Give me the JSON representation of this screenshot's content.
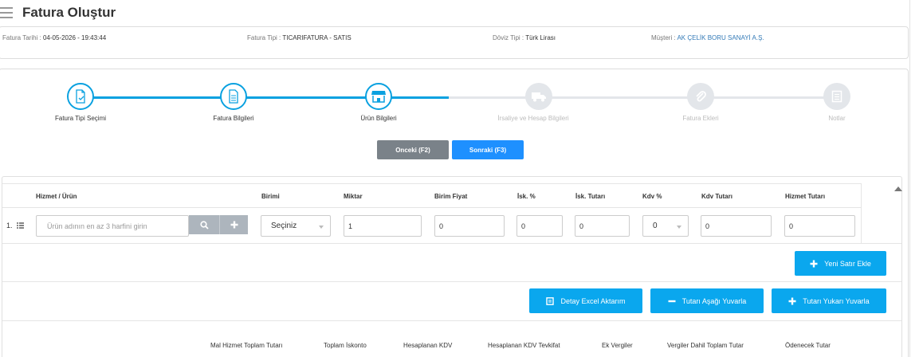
{
  "header": {
    "title": "Fatura Oluştur",
    "menu_icon": "hamburger-icon"
  },
  "info": {
    "date_label": "Fatura Tarihi : ",
    "date_value": "04-05-2026 - 19:43:44",
    "type_label": "Fatura Tipi : ",
    "type_value": "TICARIFATURA - SATIS",
    "currency_label": "Döviz Tipi : ",
    "currency_value": "Türk Lirası",
    "customer_label": "Müşteri : ",
    "customer_value": "AK ÇELİK BORU SANAYİ A.Ş."
  },
  "steps": [
    {
      "label": "Fatura Tipi Seçimi",
      "icon": "document-check-icon",
      "state": "done"
    },
    {
      "label": "Fatura Bilgileri",
      "icon": "document-text-icon",
      "state": "done"
    },
    {
      "label": "Ürün Bilgileri",
      "icon": "store-icon",
      "state": "active"
    },
    {
      "label": "İrsaliye ve Hesap Bilgileri",
      "icon": "truck-icon",
      "state": "pending"
    },
    {
      "label": "Fatura Ekleri",
      "icon": "paperclip-icon",
      "state": "pending"
    },
    {
      "label": "Notlar",
      "icon": "notes-icon",
      "state": "pending"
    }
  ],
  "nav": {
    "prev_label": "Onceki (F2)",
    "next_label": "Sonraki (F3)"
  },
  "table": {
    "columns": [
      "Hizmet / Ürün",
      "Birimi",
      "Miktar",
      "Birim Fiyat",
      "İsk. %",
      "İsk. Tutarı",
      "Kdv %",
      "Kdv Tutarı",
      "Hizmet Tutarı"
    ],
    "row": {
      "number": "1.",
      "product_placeholder": "Ürün adının en az 3 harfini girin",
      "unit": "Seçiniz",
      "quantity": "1",
      "unit_price": "0",
      "discount_pct": "0",
      "discount_amount": "0",
      "vat_pct": "0",
      "vat_amount": "0",
      "service_amount": "0"
    }
  },
  "actions": {
    "add_row": "Yeni Satır Ekle",
    "excel": "Detay Excel Aktarım",
    "round_down": "Tutarı Aşağı Yuvarla",
    "round_up": "Tutarı Yukarı Yuvarla"
  },
  "summary": [
    "Mal Hizmet Toplam Tutarı",
    "Toplam İskonto",
    "Hesaplanan KDV",
    "Hesaplanan KDV Tevkifat",
    "Ek Vergiler",
    "Vergiler Dahil Toplam Tutar",
    "Ödenecek Tutar"
  ],
  "colors": {
    "accent": "#0aa1e0",
    "button": "#0aa7ee",
    "primary": "#1e90ff",
    "secondary": "#7a8289",
    "inactive": "#e3e6ea"
  }
}
